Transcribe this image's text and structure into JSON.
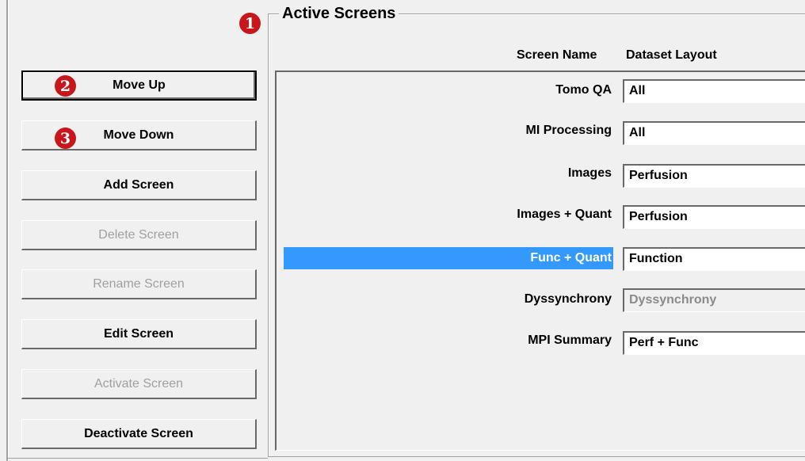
{
  "buttons": {
    "move_up": "Move Up",
    "move_down": "Move Down",
    "add_screen": "Add Screen",
    "delete_screen": "Delete Screen",
    "rename_screen": "Rename Screen",
    "edit_screen": "Edit Screen",
    "activate_screen": "Activate Screen",
    "deactivate_screen": "Deactivate Screen"
  },
  "badges": {
    "one": "1",
    "two": "2",
    "three": "3"
  },
  "group": {
    "title": "Active Screens",
    "col_screen_name": "Screen Name",
    "col_dataset_layout": "Dataset Layout"
  },
  "rows": [
    {
      "name": "Tomo QA",
      "layout": "All"
    },
    {
      "name": "MI Processing",
      "layout": "All"
    },
    {
      "name": "Images",
      "layout": "Perfusion"
    },
    {
      "name": "Images + Quant",
      "layout": "Perfusion"
    },
    {
      "name": "Func + Quant",
      "layout": "Function"
    },
    {
      "name": "Dyssynchrony",
      "layout": "Dyssynchrony"
    },
    {
      "name": "MPI Summary",
      "layout": "Perf + Func"
    }
  ],
  "icons": {
    "dropdown": "chevron-down-icon"
  },
  "colors": {
    "selection": "#3399ff",
    "badge": "#c8161d",
    "window_bg": "#f0f0f0"
  }
}
